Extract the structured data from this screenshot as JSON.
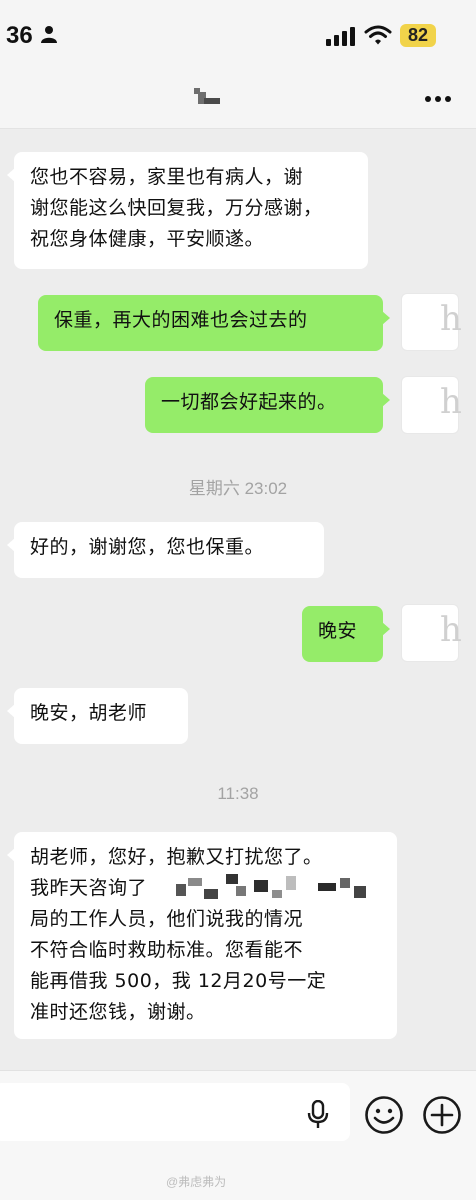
{
  "status_bar": {
    "time": "36",
    "battery": "82",
    "icons": [
      "person-icon",
      "signal-icon",
      "wifi-icon"
    ]
  },
  "nav": {
    "contact_name": "",
    "more_icon": "more-icon"
  },
  "messages": [
    {
      "side": "in",
      "text": "您也不容易，家里也有病人，谢\n谢您能这么快回复我，万分感谢，\n祝您身体健康，平安顺遂。"
    },
    {
      "side": "out",
      "text": "保重，再大的困难也会过去的"
    },
    {
      "side": "out",
      "text": "一切都会好起来的。"
    },
    {
      "side": "time",
      "text": "星期六 23:02"
    },
    {
      "side": "in",
      "text": "好的，谢谢您，您也保重。"
    },
    {
      "side": "out",
      "text": "晚安"
    },
    {
      "side": "in",
      "text": "晚安，胡老师"
    },
    {
      "side": "time",
      "text": "11:38"
    },
    {
      "side": "in",
      "text": "胡老师，您好，抱歉又打扰您了。\n我昨天咨询了                              \n局的工作人员，他们说我的情况\n不符合临时救助标准。您看能不\n能再借我 500，我 12月20号一定\n准时还您钱，谢谢。"
    }
  ],
  "avatar_glyph": "h",
  "input_bar": {
    "icons": [
      "voice-icon",
      "emoji-icon",
      "add-icon"
    ]
  },
  "watermark": "@弗虑弗为",
  "colors": {
    "outgoing_bubble": "#95ec69",
    "incoming_bubble": "#ffffff",
    "background": "#ededed",
    "battery": "#f1d34a"
  }
}
